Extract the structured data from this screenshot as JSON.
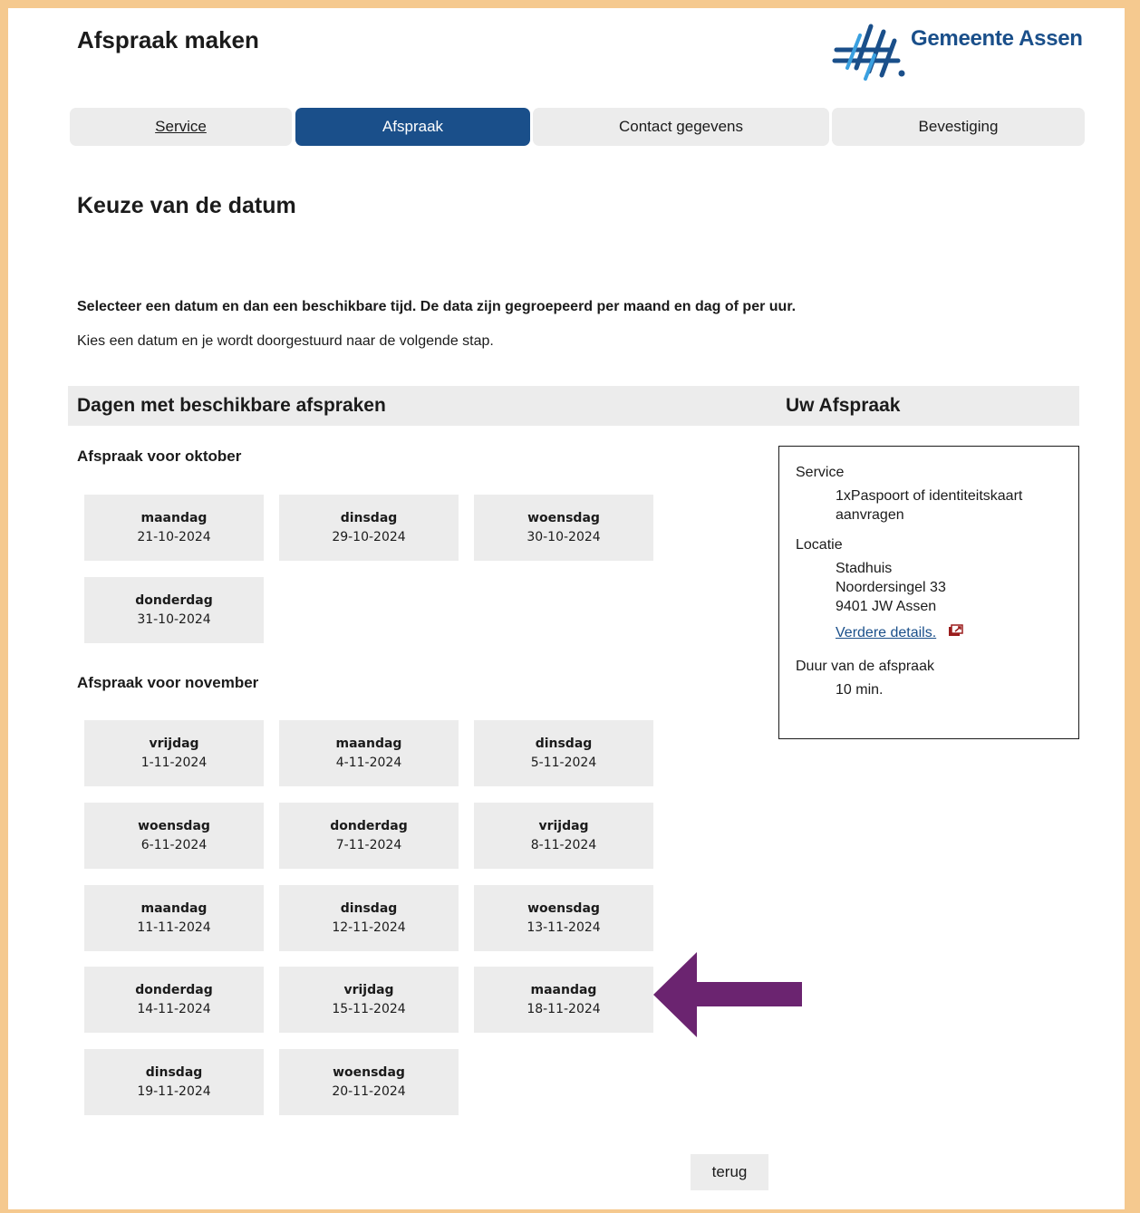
{
  "header": {
    "title": "Afspraak maken",
    "logo_text": "Gemeente Assen"
  },
  "steps": [
    {
      "label": "Service",
      "state": "link"
    },
    {
      "label": "Afspraak",
      "state": "active"
    },
    {
      "label": "Contact gegevens",
      "state": "inactive"
    },
    {
      "label": "Bevestiging",
      "state": "inactive"
    }
  ],
  "heading": "Keuze van de datum",
  "intro_bold": "Selecteer een datum en dan een beschikbare tijd. De data zijn gegroepeerd per maand en dag of per uur.",
  "intro": "Kies een datum en je wordt doorgestuurd naar de volgende stap.",
  "section": {
    "left_title": "Dagen met beschikbare afspraken",
    "right_title": "Uw Afspraak"
  },
  "months": [
    {
      "title": "Afspraak voor oktober",
      "days": [
        {
          "day": "maandag",
          "date": "21-10-2024"
        },
        {
          "day": "dinsdag",
          "date": "29-10-2024"
        },
        {
          "day": "woensdag",
          "date": "30-10-2024"
        },
        {
          "day": "donderdag",
          "date": "31-10-2024"
        }
      ]
    },
    {
      "title": "Afspraak voor november",
      "days": [
        {
          "day": "vrijdag",
          "date": "1-11-2024"
        },
        {
          "day": "maandag",
          "date": "4-11-2024"
        },
        {
          "day": "dinsdag",
          "date": "5-11-2024"
        },
        {
          "day": "woensdag",
          "date": "6-11-2024"
        },
        {
          "day": "donderdag",
          "date": "7-11-2024"
        },
        {
          "day": "vrijdag",
          "date": "8-11-2024"
        },
        {
          "day": "maandag",
          "date": "11-11-2024"
        },
        {
          "day": "dinsdag",
          "date": "12-11-2024"
        },
        {
          "day": "woensdag",
          "date": "13-11-2024"
        },
        {
          "day": "donderdag",
          "date": "14-11-2024"
        },
        {
          "day": "vrijdag",
          "date": "15-11-2024"
        },
        {
          "day": "maandag",
          "date": "18-11-2024"
        },
        {
          "day": "dinsdag",
          "date": "19-11-2024"
        },
        {
          "day": "woensdag",
          "date": "20-11-2024"
        }
      ]
    }
  ],
  "summary": {
    "service_label": "Service",
    "service_value": "1xPaspoort of identiteitskaart aanvragen",
    "location_label": "Locatie",
    "location_name": "Stadhuis",
    "location_street": "Noordersingel 33",
    "location_city": "9401 JW Assen",
    "details_link": "Verdere details.",
    "duration_label": "Duur van de afspraak",
    "duration_value": "10 min."
  },
  "back_button": "terug",
  "colors": {
    "primary": "#1a4f8a",
    "tile_bg": "#ececec",
    "frame_border": "#f5c98f",
    "arrow": "#6b2470",
    "link_icon": "#9b1d1d"
  },
  "icons": {
    "logo": "gemeente-assen-logo",
    "external_link": "external-link-icon",
    "pointer_arrow": "left-arrow-annotation"
  }
}
